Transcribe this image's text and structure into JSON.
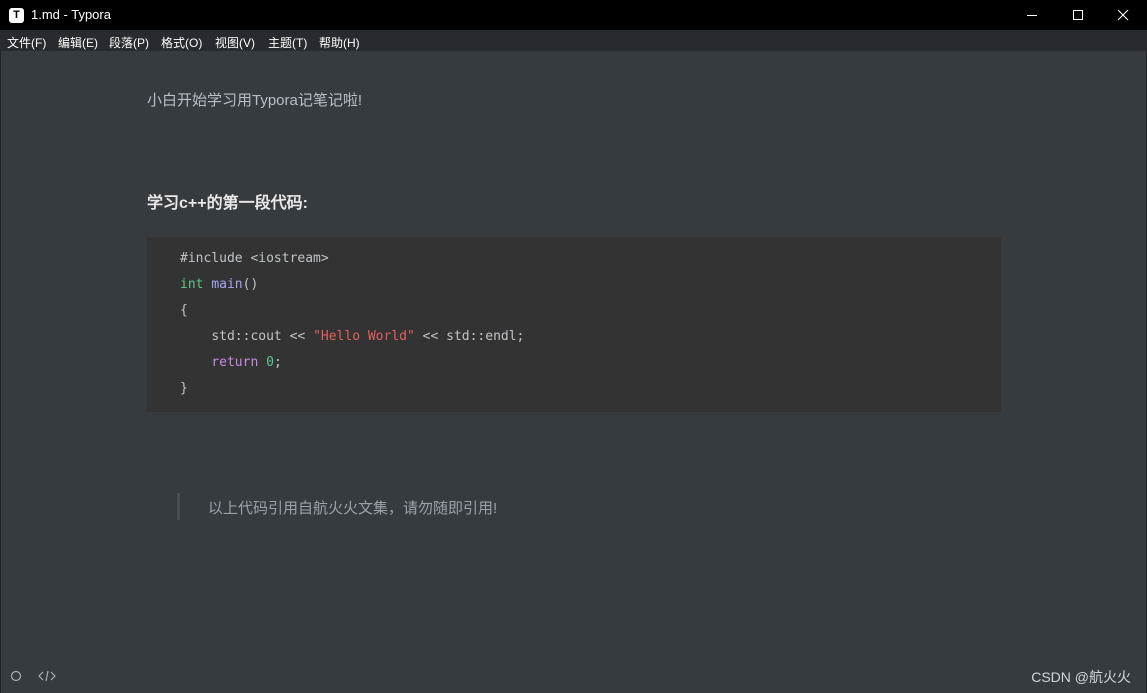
{
  "window": {
    "title": "1.md - Typora",
    "app_icon_letter": "T"
  },
  "menu": [
    "文件(F)",
    "编辑(E)",
    "段落(P)",
    "格式(O)",
    "视图(V)",
    "主题(T)",
    "帮助(H)"
  ],
  "document": {
    "paragraph": "小白开始学习用Typora记笔记啦!",
    "heading": "学习c++的第一段代码:",
    "code": {
      "language": "cpp",
      "lines": [
        "#include <iostream>",
        "int main()",
        "{",
        "    std::cout << \"Hello World\" << std::endl;",
        "    return 0;",
        "}"
      ],
      "tokens": {
        "l1": "#include <iostream>",
        "l2_type": "int",
        "l2_func": "main",
        "l2_rest": "()",
        "l3": "{",
        "l4_a": "std::cout << ",
        "l4_str": "\"Hello World\"",
        "l4_b": " << std::endl;",
        "l5_kw": "return",
        "l5_num": "0",
        "l5_end": ";",
        "l6": "}"
      }
    },
    "blockquote": "以上代码引用自航火火文集，请勿随即引用!"
  },
  "footer": {
    "watermark": "CSDN @航火火",
    "left_icons": [
      "circle-icon",
      "source-code-icon"
    ]
  },
  "colors": {
    "editor_bg": "#363b40",
    "titlebar_bg": "#000000",
    "menubar_bg": "#272a2e",
    "code_bg": "#333333",
    "keyword_type": "#5ec78a",
    "function": "#a7a5f0",
    "string": "#e0615e",
    "keyword": "#c48edb"
  }
}
